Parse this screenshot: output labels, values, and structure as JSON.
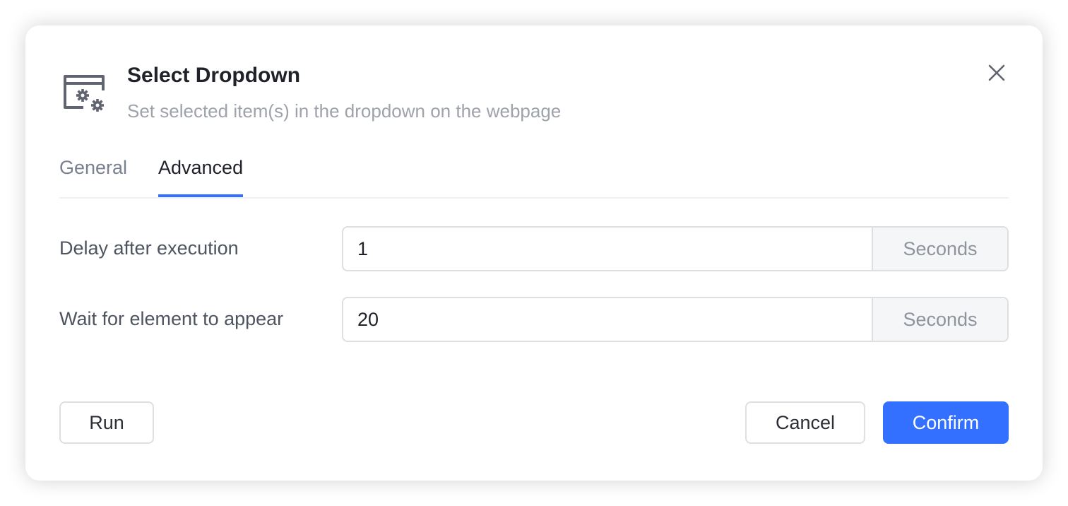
{
  "dialog": {
    "icon": "browser-gear-icon",
    "title": "Select Dropdown",
    "subtitle": "Set selected item(s) in the dropdown on the webpage",
    "close_icon": "close-icon"
  },
  "tabs": [
    {
      "label": "General",
      "active": false
    },
    {
      "label": "Advanced",
      "active": true
    }
  ],
  "fields": [
    {
      "label": "Delay after execution",
      "value": "1",
      "suffix": "Seconds"
    },
    {
      "label": "Wait for element to appear",
      "value": "20",
      "suffix": "Seconds"
    }
  ],
  "buttons": {
    "run": "Run",
    "cancel": "Cancel",
    "confirm": "Confirm"
  },
  "colors": {
    "accent": "#3370ff"
  }
}
